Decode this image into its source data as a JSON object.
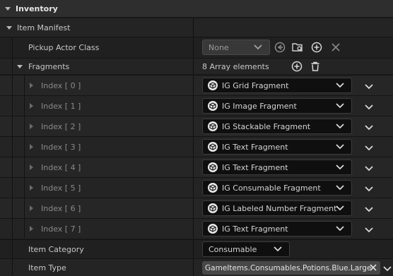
{
  "category": {
    "title": "Inventory"
  },
  "manifest": {
    "title": "Item Manifest"
  },
  "pickup": {
    "label": "Pickup Actor Class",
    "value": "None",
    "icons": [
      "use-selected-icon",
      "browse-folder-icon",
      "add-icon",
      "clear-icon"
    ]
  },
  "fragments": {
    "label": "Fragments",
    "count_text": "8 Array elements",
    "icons": [
      "add-icon",
      "trash-icon"
    ],
    "items": [
      {
        "index": "Index [ 0 ]",
        "value": "IG Grid Fragment"
      },
      {
        "index": "Index [ 1 ]",
        "value": "IG Image Fragment"
      },
      {
        "index": "Index [ 2 ]",
        "value": "IG Stackable Fragment"
      },
      {
        "index": "Index [ 3 ]",
        "value": "IG Text Fragment"
      },
      {
        "index": "Index [ 4 ]",
        "value": "IG Text Fragment"
      },
      {
        "index": "Index [ 5 ]",
        "value": "IG Consumable Fragment"
      },
      {
        "index": "Index [ 6 ]",
        "value": "IG Labeled Number Fragment"
      },
      {
        "index": "Index [ 7 ]",
        "value": "IG Text Fragment"
      }
    ]
  },
  "item_category": {
    "label": "Item Category",
    "value": "Consumable"
  },
  "item_type": {
    "label": "Item Type",
    "value": "GameItems.Consumables.Potions.Blue.Large"
  }
}
